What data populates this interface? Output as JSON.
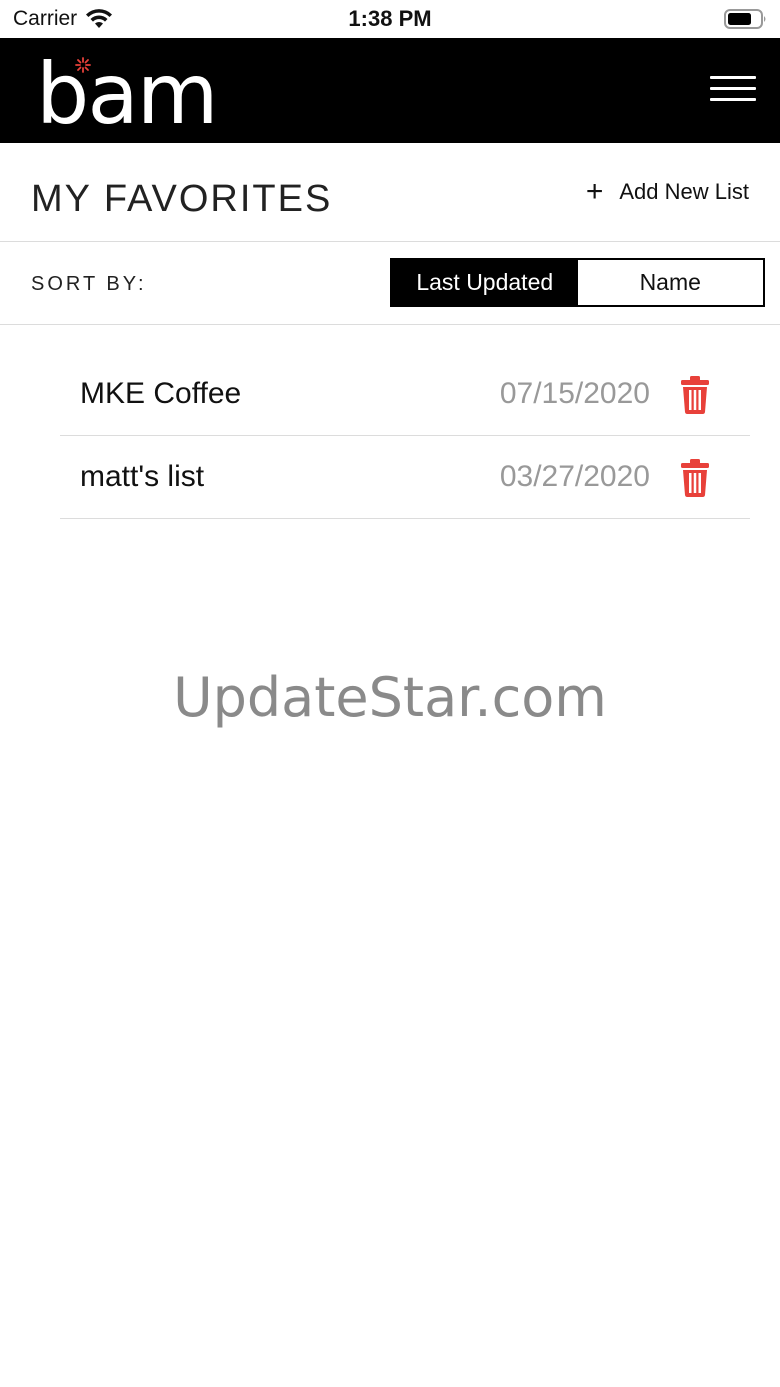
{
  "status_bar": {
    "carrier": "Carrier",
    "time": "1:38 PM"
  },
  "header": {
    "logo_text": "bam",
    "menu_icon": "hamburger-menu-icon"
  },
  "page": {
    "title": "MY FAVORITES",
    "add_new_list_label": "Add New List",
    "add_icon": "plus-icon"
  },
  "sort": {
    "label": "SORT BY:",
    "options": [
      "Last Updated",
      "Name"
    ],
    "selected": "Last Updated"
  },
  "lists": [
    {
      "name": "MKE Coffee",
      "date": "07/15/2020"
    },
    {
      "name": "matt's list",
      "date": "03/27/2020"
    }
  ],
  "watermark": "UpdateStar.com",
  "colors": {
    "header_bg": "#000000",
    "delete_icon": "#e8413a",
    "date_text": "#999999",
    "logo_spark": "#e8413a"
  }
}
